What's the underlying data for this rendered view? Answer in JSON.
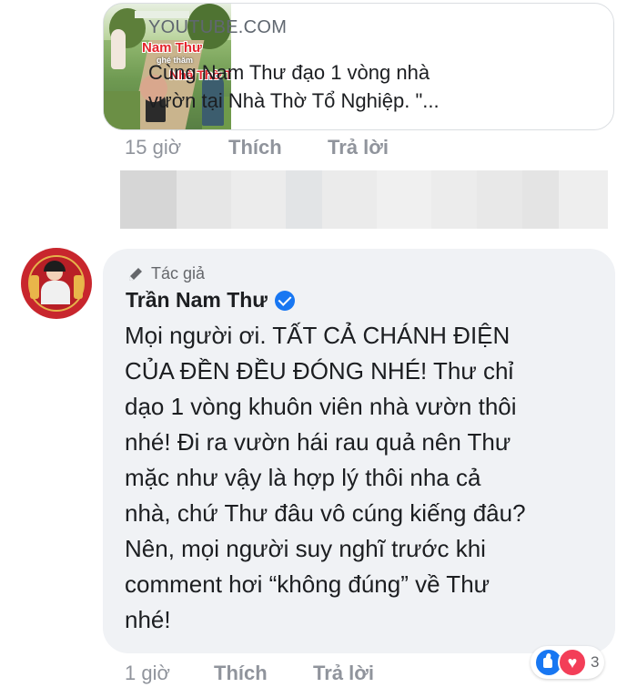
{
  "link_preview": {
    "domain": "YOUTUBE.COM",
    "title_lines": [
      "Cùng Nam Thư đạo 1 vòng nhà",
      "vườn tại Nhà Thờ Tổ Nghiệp. \"..."
    ],
    "thumbnail_text": {
      "line1": "Nam Thư",
      "line2": "ghé thăm",
      "line3": "Nhà Thờ Tổ"
    }
  },
  "first_actions": {
    "time": "15 giờ",
    "like": "Thích",
    "reply": "Trả lời"
  },
  "blurred_strip_colors": [
    "#d6d6d6",
    "#e6e6e6",
    "#ececec",
    "#e2e4e6",
    "#ebebeb",
    "#f0f0f0",
    "#ececec",
    "#e8e8e8",
    "#e4e4e4",
    "#eeeeee"
  ],
  "comment": {
    "author_badge": "Tác giả",
    "author": "Trần Nam Thư",
    "text_lines": [
      "Mọi người ơi. TẤT CẢ CHÁNH ĐIỆN",
      "CỦA ĐỀN ĐỀU ĐÓNG NHÉ! Thư chỉ",
      "dạo 1 vòng khuôn viên nhà vườn thôi",
      "nhé! Đi ra vườn hái rau quả nên Thư",
      "mặc như vậy là hợp lý thôi nha cả",
      "nhà, chứ Thư đâu vô cúng kiếng đâu?",
      "Nên, mọi người suy nghĩ trước khi",
      "comment hơi “không đúng” về Thư",
      "nhé!"
    ],
    "reactions": {
      "types": [
        "like-icon",
        "love-icon"
      ],
      "count": "3"
    }
  },
  "second_actions": {
    "time": "1 giờ",
    "like": "Thích",
    "reply": "Trả lời"
  }
}
